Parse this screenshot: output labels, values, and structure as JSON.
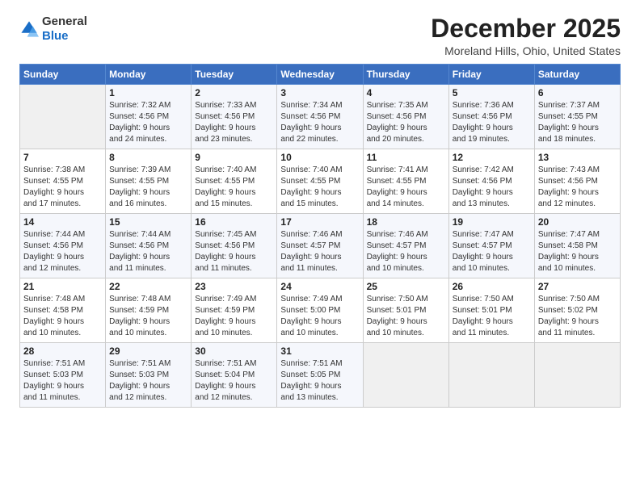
{
  "logo": {
    "general": "General",
    "blue": "Blue"
  },
  "header": {
    "title": "December 2025",
    "subtitle": "Moreland Hills, Ohio, United States"
  },
  "weekdays": [
    "Sunday",
    "Monday",
    "Tuesday",
    "Wednesday",
    "Thursday",
    "Friday",
    "Saturday"
  ],
  "weeks": [
    [
      {
        "day": "",
        "info": ""
      },
      {
        "day": "1",
        "info": "Sunrise: 7:32 AM\nSunset: 4:56 PM\nDaylight: 9 hours\nand 24 minutes."
      },
      {
        "day": "2",
        "info": "Sunrise: 7:33 AM\nSunset: 4:56 PM\nDaylight: 9 hours\nand 23 minutes."
      },
      {
        "day": "3",
        "info": "Sunrise: 7:34 AM\nSunset: 4:56 PM\nDaylight: 9 hours\nand 22 minutes."
      },
      {
        "day": "4",
        "info": "Sunrise: 7:35 AM\nSunset: 4:56 PM\nDaylight: 9 hours\nand 20 minutes."
      },
      {
        "day": "5",
        "info": "Sunrise: 7:36 AM\nSunset: 4:56 PM\nDaylight: 9 hours\nand 19 minutes."
      },
      {
        "day": "6",
        "info": "Sunrise: 7:37 AM\nSunset: 4:55 PM\nDaylight: 9 hours\nand 18 minutes."
      }
    ],
    [
      {
        "day": "7",
        "info": "Sunrise: 7:38 AM\nSunset: 4:55 PM\nDaylight: 9 hours\nand 17 minutes."
      },
      {
        "day": "8",
        "info": "Sunrise: 7:39 AM\nSunset: 4:55 PM\nDaylight: 9 hours\nand 16 minutes."
      },
      {
        "day": "9",
        "info": "Sunrise: 7:40 AM\nSunset: 4:55 PM\nDaylight: 9 hours\nand 15 minutes."
      },
      {
        "day": "10",
        "info": "Sunrise: 7:40 AM\nSunset: 4:55 PM\nDaylight: 9 hours\nand 15 minutes."
      },
      {
        "day": "11",
        "info": "Sunrise: 7:41 AM\nSunset: 4:55 PM\nDaylight: 9 hours\nand 14 minutes."
      },
      {
        "day": "12",
        "info": "Sunrise: 7:42 AM\nSunset: 4:56 PM\nDaylight: 9 hours\nand 13 minutes."
      },
      {
        "day": "13",
        "info": "Sunrise: 7:43 AM\nSunset: 4:56 PM\nDaylight: 9 hours\nand 12 minutes."
      }
    ],
    [
      {
        "day": "14",
        "info": "Sunrise: 7:44 AM\nSunset: 4:56 PM\nDaylight: 9 hours\nand 12 minutes."
      },
      {
        "day": "15",
        "info": "Sunrise: 7:44 AM\nSunset: 4:56 PM\nDaylight: 9 hours\nand 11 minutes."
      },
      {
        "day": "16",
        "info": "Sunrise: 7:45 AM\nSunset: 4:56 PM\nDaylight: 9 hours\nand 11 minutes."
      },
      {
        "day": "17",
        "info": "Sunrise: 7:46 AM\nSunset: 4:57 PM\nDaylight: 9 hours\nand 11 minutes."
      },
      {
        "day": "18",
        "info": "Sunrise: 7:46 AM\nSunset: 4:57 PM\nDaylight: 9 hours\nand 10 minutes."
      },
      {
        "day": "19",
        "info": "Sunrise: 7:47 AM\nSunset: 4:57 PM\nDaylight: 9 hours\nand 10 minutes."
      },
      {
        "day": "20",
        "info": "Sunrise: 7:47 AM\nSunset: 4:58 PM\nDaylight: 9 hours\nand 10 minutes."
      }
    ],
    [
      {
        "day": "21",
        "info": "Sunrise: 7:48 AM\nSunset: 4:58 PM\nDaylight: 9 hours\nand 10 minutes."
      },
      {
        "day": "22",
        "info": "Sunrise: 7:48 AM\nSunset: 4:59 PM\nDaylight: 9 hours\nand 10 minutes."
      },
      {
        "day": "23",
        "info": "Sunrise: 7:49 AM\nSunset: 4:59 PM\nDaylight: 9 hours\nand 10 minutes."
      },
      {
        "day": "24",
        "info": "Sunrise: 7:49 AM\nSunset: 5:00 PM\nDaylight: 9 hours\nand 10 minutes."
      },
      {
        "day": "25",
        "info": "Sunrise: 7:50 AM\nSunset: 5:01 PM\nDaylight: 9 hours\nand 10 minutes."
      },
      {
        "day": "26",
        "info": "Sunrise: 7:50 AM\nSunset: 5:01 PM\nDaylight: 9 hours\nand 11 minutes."
      },
      {
        "day": "27",
        "info": "Sunrise: 7:50 AM\nSunset: 5:02 PM\nDaylight: 9 hours\nand 11 minutes."
      }
    ],
    [
      {
        "day": "28",
        "info": "Sunrise: 7:51 AM\nSunset: 5:03 PM\nDaylight: 9 hours\nand 11 minutes."
      },
      {
        "day": "29",
        "info": "Sunrise: 7:51 AM\nSunset: 5:03 PM\nDaylight: 9 hours\nand 12 minutes."
      },
      {
        "day": "30",
        "info": "Sunrise: 7:51 AM\nSunset: 5:04 PM\nDaylight: 9 hours\nand 12 minutes."
      },
      {
        "day": "31",
        "info": "Sunrise: 7:51 AM\nSunset: 5:05 PM\nDaylight: 9 hours\nand 13 minutes."
      },
      {
        "day": "",
        "info": ""
      },
      {
        "day": "",
        "info": ""
      },
      {
        "day": "",
        "info": ""
      }
    ]
  ]
}
